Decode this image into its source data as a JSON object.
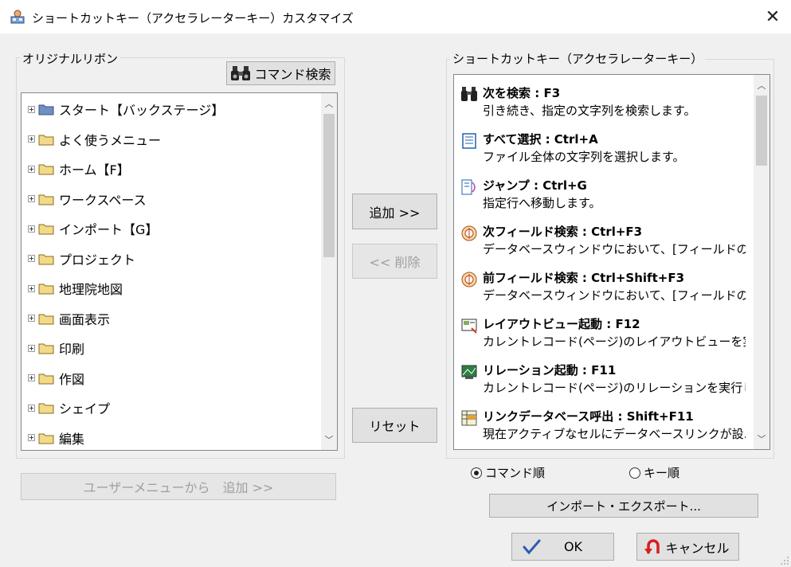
{
  "window": {
    "title": "ショートカットキー（アクセラレーターキー）カスタマイズ",
    "close_glyph": "✕"
  },
  "left_group": {
    "label": "オリジナルリボン",
    "search_button": "コマンド検索",
    "tree": [
      {
        "label": "スタート【バックステージ】",
        "folder": "blue"
      },
      {
        "label": "よく使うメニュー",
        "folder": "yellow"
      },
      {
        "label": "ホーム【F】",
        "folder": "yellow"
      },
      {
        "label": "ワークスペース",
        "folder": "yellow"
      },
      {
        "label": "インポート【G】",
        "folder": "yellow"
      },
      {
        "label": "プロジェクト",
        "folder": "yellow"
      },
      {
        "label": "地理院地図",
        "folder": "yellow"
      },
      {
        "label": "画面表示",
        "folder": "yellow"
      },
      {
        "label": "印刷",
        "folder": "yellow"
      },
      {
        "label": "作図",
        "folder": "yellow"
      },
      {
        "label": "シェイプ",
        "folder": "yellow"
      },
      {
        "label": "編集",
        "folder": "yellow"
      }
    ]
  },
  "middle": {
    "add_button": "追加 >>",
    "delete_button": "<< 削除",
    "reset_button": "リセット",
    "user_menu_button": "ユーザーメニューから　追加 >>"
  },
  "right_group": {
    "label": "ショートカットキー（アクセラレーターキー）",
    "items": [
      {
        "title": "次を検索 : F3",
        "desc": "引き続き、指定の文字列を検索します。",
        "icon": "binoculars-icon"
      },
      {
        "title": "すべて選択 : Ctrl+A",
        "desc": "ファイル全体の文字列を選択します。",
        "icon": "select-all-icon"
      },
      {
        "title": "ジャンプ : Ctrl+G",
        "desc": "指定行へ移動します。",
        "icon": "jump-icon"
      },
      {
        "title": "次フィールド検索 : Ctrl+F3",
        "desc": "データベースウィンドウにおいて、[フィールドの検...",
        "icon": "field-search-icon"
      },
      {
        "title": "前フィールド検索 : Ctrl+Shift+F3",
        "desc": "データベースウィンドウにおいて、[フィールドの検...",
        "icon": "field-search-icon"
      },
      {
        "title": "レイアウトビュー起動 : F12",
        "desc": "カレントレコード(ページ)のレイアウトビューを実行...",
        "icon": "layout-view-icon"
      },
      {
        "title": "リレーション起動 : F11",
        "desc": "カレントレコード(ページ)のリレーションを実行しま...",
        "icon": "relation-icon"
      },
      {
        "title": "リンクデータベース呼出 : Shift+F11",
        "desc": "現在アクティブなセルにデータベースリンクが設...",
        "icon": "link-database-icon"
      }
    ],
    "sort_command": "コマンド順",
    "sort_key": "キー順",
    "import_export_button": "インポート・エクスポート..."
  },
  "footer": {
    "ok_button": "OK",
    "cancel_button": "キャンセル"
  },
  "colors": {
    "ok_check": "#2a5db0",
    "cancel_arrow": "#d81e1e",
    "folder_yellow": "#f3d98a",
    "folder_blue": "#6f8fc6"
  }
}
